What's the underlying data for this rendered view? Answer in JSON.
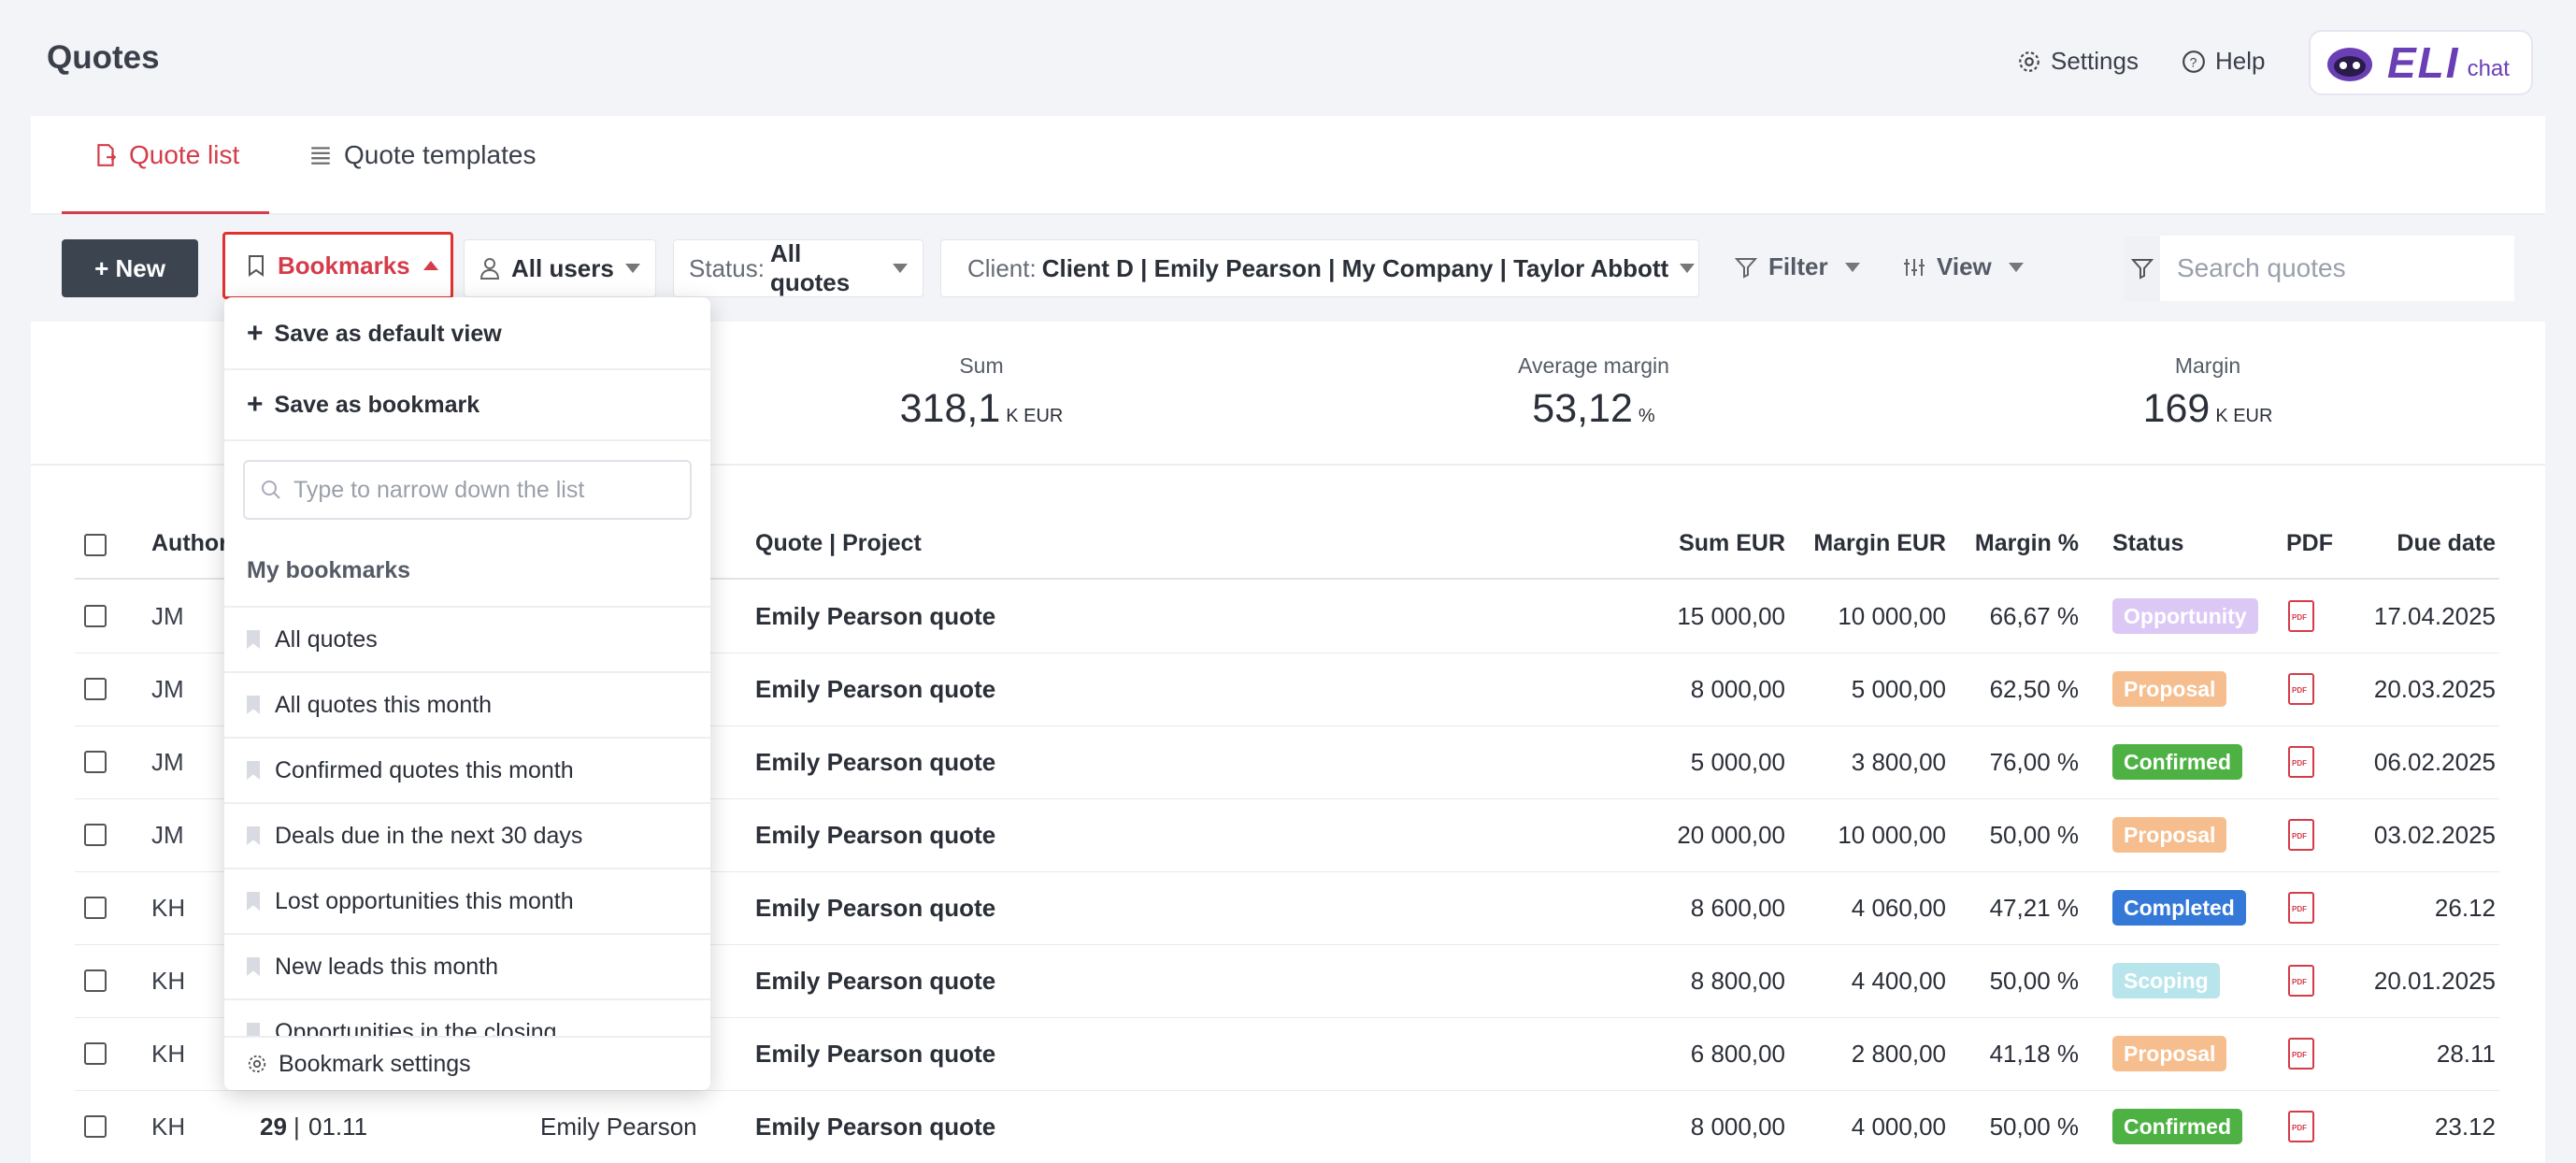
{
  "page": {
    "title": "Quotes"
  },
  "topnav": {
    "settings": "Settings",
    "help": "Help",
    "logo_text": "ELI",
    "logo_sub": "chat"
  },
  "tabs": [
    {
      "label": "Quote list",
      "active": true
    },
    {
      "label": "Quote templates",
      "active": false
    }
  ],
  "toolbar": {
    "new_label": "+ New",
    "bookmarks_label": "Bookmarks",
    "users_label": "All users",
    "status_prefix": "Status:",
    "status_value": "All quotes",
    "client_prefix": "Client:",
    "client_value": "Client D | Emily Pearson | My Company | Taylor Abbott",
    "filter_label": "Filter",
    "view_label": "View",
    "search_placeholder": "Search quotes"
  },
  "kpis": [
    {
      "label": "Sum",
      "value": "318,1",
      "unit": "K EUR"
    },
    {
      "label": "Average margin",
      "value": "53,12",
      "unit": "%"
    },
    {
      "label": "Margin",
      "value": "169",
      "unit": "K EUR"
    }
  ],
  "table": {
    "headers": {
      "author": "Author",
      "quote_project": "Quote | Project",
      "sum": "Sum EUR",
      "margin": "Margin EUR",
      "margin_pct": "Margin %",
      "status": "Status",
      "pdf": "PDF",
      "due": "Due date"
    },
    "rows": [
      {
        "author": "JM",
        "quote": "Emily Pearson quote",
        "sum": "15 000,00",
        "margin": "10 000,00",
        "pct": "66,67 %",
        "status": "Opportunity",
        "status_color": "#dcc8f5",
        "due": "17.04.2025"
      },
      {
        "author": "JM",
        "quote": "Emily Pearson quote",
        "sum": "8 000,00",
        "margin": "5 000,00",
        "pct": "62,50 %",
        "status": "Proposal",
        "status_color": "#f6be8e",
        "due": "20.03.2025"
      },
      {
        "author": "JM",
        "quote": "Emily Pearson quote",
        "sum": "5 000,00",
        "margin": "3 800,00",
        "pct": "76,00 %",
        "status": "Confirmed",
        "status_color": "#4db243",
        "due": "06.02.2025"
      },
      {
        "author": "JM",
        "quote": "Emily Pearson quote",
        "sum": "20 000,00",
        "margin": "10 000,00",
        "pct": "50,00 %",
        "status": "Proposal",
        "status_color": "#f6be8e",
        "due": "03.02.2025"
      },
      {
        "author": "KH",
        "quote": "Emily Pearson quote",
        "sum": "8 600,00",
        "margin": "4 060,00",
        "pct": "47,21 %",
        "status": "Completed",
        "status_color": "#3579d8",
        "due": "26.12"
      },
      {
        "author": "KH",
        "quote": "Emily Pearson quote",
        "sum": "8 800,00",
        "margin": "4 400,00",
        "pct": "50,00 %",
        "status": "Scoping",
        "status_color": "#b8e4ec",
        "due": "20.01.2025"
      },
      {
        "author": "KH",
        "quote": "Emily Pearson quote",
        "sum": "6 800,00",
        "margin": "2 800,00",
        "pct": "41,18 %",
        "status": "Proposal",
        "status_color": "#f6be8e",
        "due": "28.11"
      },
      {
        "author": "KH",
        "number": "29",
        "date": "01.11",
        "client": "Emily Pearson",
        "quote": "Emily Pearson quote",
        "sum": "8 000,00",
        "margin": "4 000,00",
        "pct": "50,00 %",
        "status": "Confirmed",
        "status_color": "#4db243",
        "due": "23.12"
      }
    ]
  },
  "dropdown": {
    "save_default": "Save as default view",
    "save_bookmark": "Save as bookmark",
    "search_placeholder": "Type to narrow down the list",
    "section_title": "My bookmarks",
    "items": [
      "All quotes",
      "All quotes this month",
      "Confirmed quotes this month",
      "Deals due in the next 30 days",
      "Lost opportunities this month",
      "New leads this month",
      "Opportunities in the closing"
    ],
    "footer": "Bookmark settings"
  }
}
